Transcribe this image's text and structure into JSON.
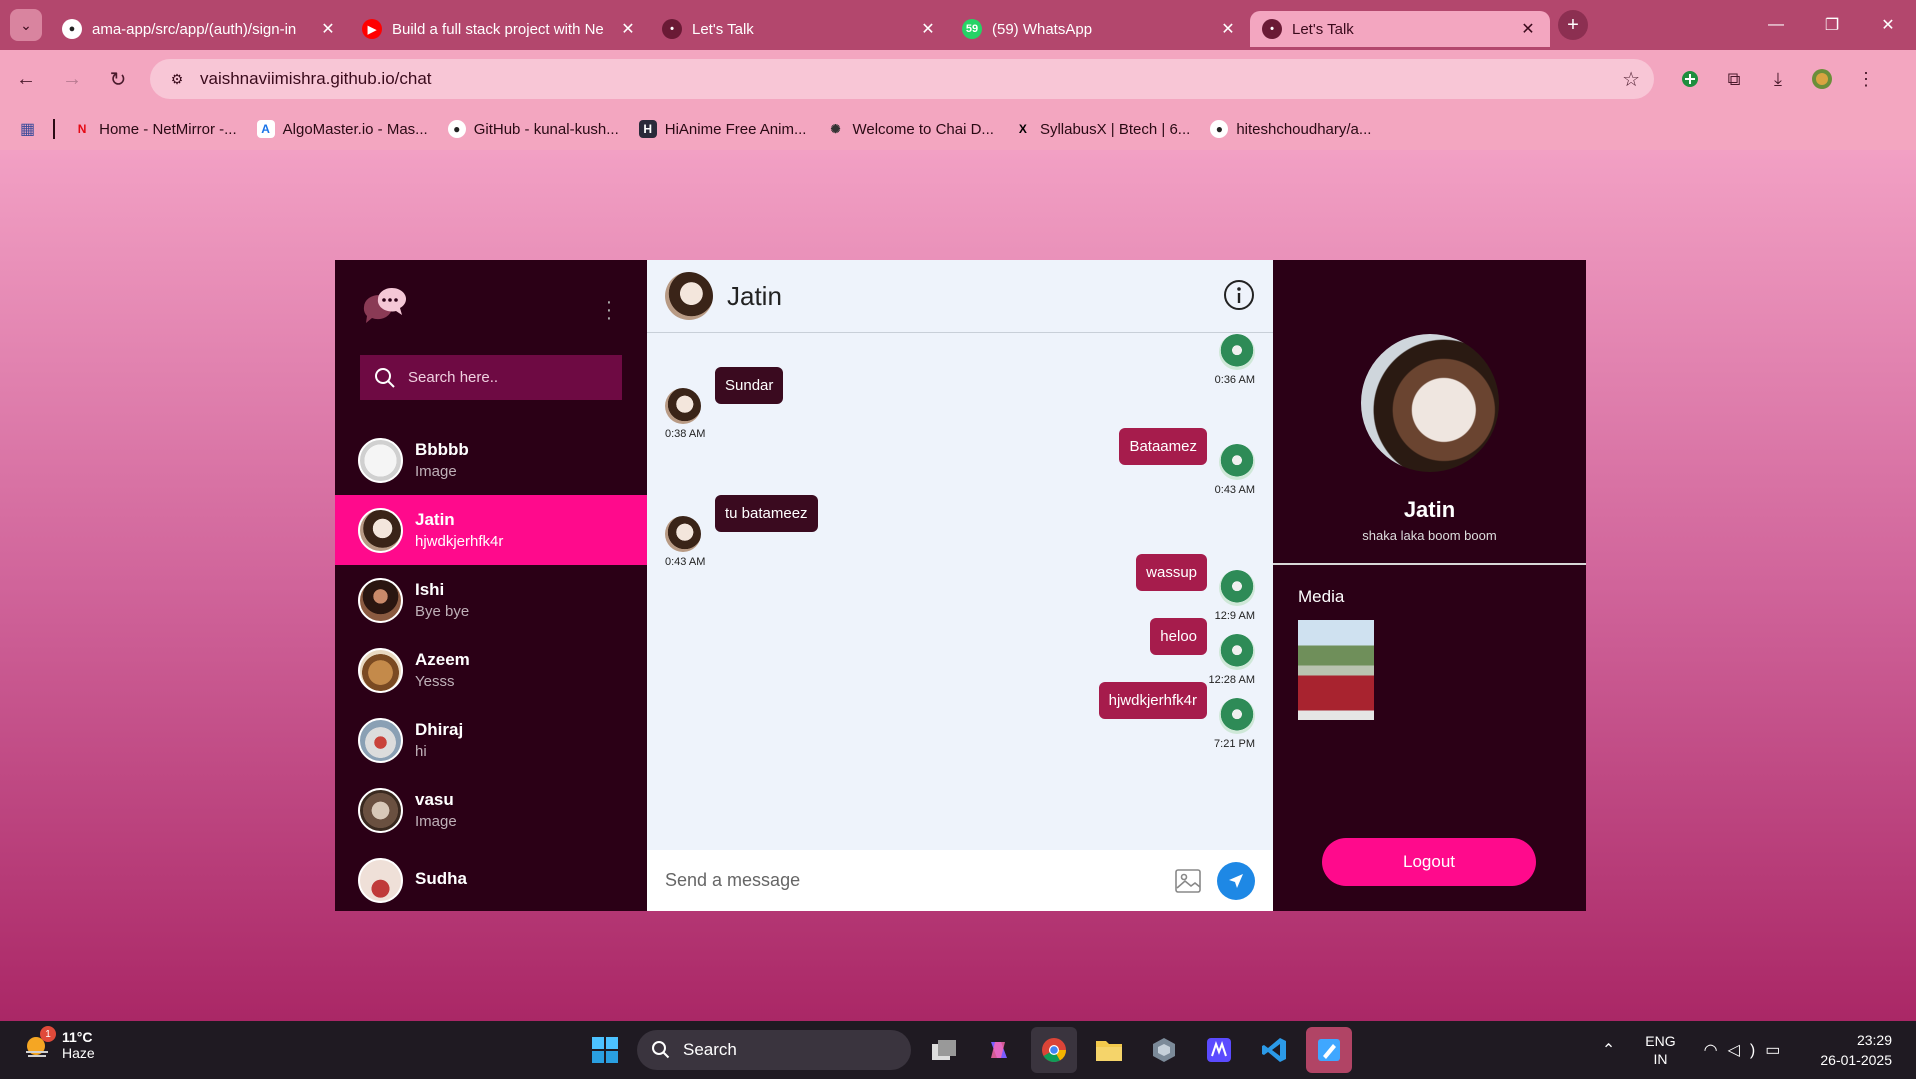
{
  "browser": {
    "tabs": [
      {
        "title": "ama-app/src/app/(auth)/sign-in",
        "favicon": "github-icon",
        "active": false
      },
      {
        "title": "Build a full stack project with Ne",
        "favicon": "youtube-icon",
        "active": false
      },
      {
        "title": "Let's Talk",
        "favicon": "app-favicon",
        "active": false
      },
      {
        "title": "(59) WhatsApp",
        "favicon": "whatsapp-icon",
        "badge": "59",
        "active": false
      },
      {
        "title": "Let's Talk",
        "favicon": "app-favicon",
        "active": true
      }
    ],
    "url": "vaishnaviimishra.github.io/chat",
    "bookmarks": [
      {
        "label": "Home - NetMirror -...",
        "icon": "netmirror-icon"
      },
      {
        "label": "AlgoMaster.io - Mas...",
        "icon": "algomaster-icon"
      },
      {
        "label": "GitHub - kunal-kush...",
        "icon": "github-icon"
      },
      {
        "label": "HiAnime Free Anim...",
        "icon": "hianime-icon"
      },
      {
        "label": "Welcome to Chai D...",
        "icon": "chai-icon"
      },
      {
        "label": "SyllabusX | Btech | 6...",
        "icon": "x-icon"
      },
      {
        "label": "hiteshchoudhary/a...",
        "icon": "github-icon"
      }
    ]
  },
  "app": {
    "search_placeholder": "Search here..",
    "contacts": [
      {
        "name": "Bbbbb",
        "last": "Image",
        "active": false
      },
      {
        "name": "Jatin",
        "last": "hjwdkjerhfk4r",
        "active": true
      },
      {
        "name": "Ishi",
        "last": "Bye bye",
        "active": false
      },
      {
        "name": "Azeem",
        "last": "Yesss",
        "active": false
      },
      {
        "name": "Dhiraj",
        "last": "hi",
        "active": false
      },
      {
        "name": "vasu",
        "last": "Image",
        "active": false
      },
      {
        "name": "Sudha",
        "last": "",
        "active": false
      }
    ],
    "chat": {
      "title": "Jatin",
      "messages": [
        {
          "dir": "out",
          "text": "",
          "time": "0:36 AM"
        },
        {
          "dir": "in",
          "text": "Sundar",
          "time": "0:38 AM"
        },
        {
          "dir": "out",
          "text": "Bataamez",
          "time": "0:43 AM"
        },
        {
          "dir": "in",
          "text": "tu batameez",
          "time": "0:43 AM"
        },
        {
          "dir": "out",
          "text": "wassup",
          "time": "12:9 AM"
        },
        {
          "dir": "out",
          "text": "heloo",
          "time": "12:28 AM"
        },
        {
          "dir": "out",
          "text": "hjwdkjerhfk4r",
          "time": "7:21 PM"
        }
      ],
      "input_placeholder": "Send a message"
    },
    "profile": {
      "name": "Jatin",
      "status": "shaka laka boom boom",
      "media_title": "Media",
      "logout_label": "Logout"
    },
    "colors": {
      "sidebar_bg": "#2b0016",
      "accent": "#ff0a8c",
      "bubble_in": "#3a0a1f",
      "bubble_out": "#a61c4c",
      "chat_bg": "#eef3fb"
    }
  },
  "taskbar": {
    "weather_temp": "11°C",
    "weather_desc": "Haze",
    "weather_badge": "1",
    "search_label": "Search",
    "lang_line1": "ENG",
    "lang_line2": "IN",
    "time": "23:29",
    "date": "26-01-2025"
  }
}
